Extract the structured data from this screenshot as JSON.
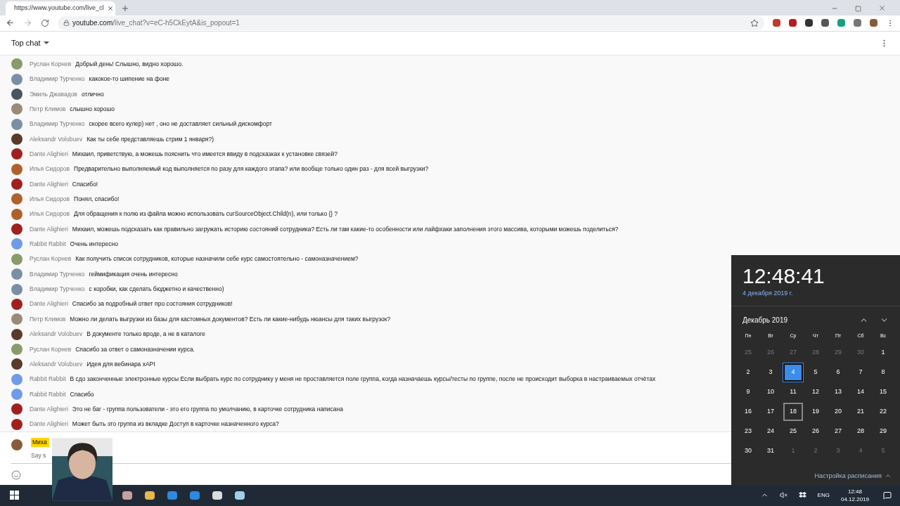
{
  "browser": {
    "tab_title": "https://www.youtube.com/live_cl",
    "url_host": "youtube.com",
    "url_path": "/live_chat?v=eC-h5CkEytA&is_popout=1"
  },
  "chat": {
    "mode": "Top chat",
    "messages": [
      {
        "author": "Руслан Корнев",
        "text": "Добрый день! Слышно, видно хорошо.",
        "color": "#8a9a6a"
      },
      {
        "author": "Владимир Турченко",
        "text": "какокое-то шипение на фоне",
        "color": "#7a8fa6"
      },
      {
        "author": "Эмиль Джавадов",
        "text": "отлично",
        "color": "#4a5562"
      },
      {
        "author": "Петр Климов",
        "text": "слышно хорошо",
        "color": "#9a8a78"
      },
      {
        "author": "Владимир Турченко",
        "text": "скорее всего кулер) нет , оно не доставляет сильный дискомфорт",
        "color": "#7a8fa6"
      },
      {
        "author": "Aleksandr Volobuev",
        "text": "Как ты себе представляешь стрим 1 января?)",
        "color": "#5a3a2a"
      },
      {
        "author": "Dante Alighieri",
        "text": "Михаил, приветствую, а можешь пояснить что имеется ввиду в подсказках к установке связей?",
        "color": "#a02020"
      },
      {
        "author": "Илья Сидоров",
        "text": "Предварительно выполняемый код выполняется по разу для каждого этапа? или вообще только один раз - для всей выгрузки?",
        "color": "#b0602a"
      },
      {
        "author": "Dante Alighieri",
        "text": "Спасибо!",
        "color": "#a02020"
      },
      {
        "author": "Илья Сидоров",
        "text": "Понял, спасибо!",
        "color": "#b0602a"
      },
      {
        "author": "Илья Сидоров",
        "text": "Для обращения к полю из файла можно использовать curSourceObject.Child(n), или только {} ?",
        "color": "#b0602a"
      },
      {
        "author": "Dante Alighieri",
        "text": "Михаил, можешь подсказать как правильно загружать историю состояний сотрудника? Есть ли там какие-то особенности или лайфхаки заполнения этого массива, которыми можешь поделиться?",
        "color": "#a02020"
      },
      {
        "author": "Rabbit Rabbit",
        "text": "Очень интересно",
        "color": "#6f9be8"
      },
      {
        "author": "Руслан Корнев",
        "text": "Как получить список сотрудников, которые назначили себе курс самостоятельно - самоназначением?",
        "color": "#8a9a6a"
      },
      {
        "author": "Владимир Турченко",
        "text": "геймификация очень интересно",
        "color": "#7a8fa6"
      },
      {
        "author": "Владимир Турченко",
        "text": "с коробки, как сделать бюджетно и качественно)",
        "color": "#7a8fa6"
      },
      {
        "author": "Dante Alighieri",
        "text": "Спасибо за подробный ответ про состояния сотрудников!",
        "color": "#a02020"
      },
      {
        "author": "Петр Климов",
        "text": "Можно ли делать выгрузки из базы для кастомных документов? Есть ли какие-нибудь нюансы для таких выгрузок?",
        "color": "#9a8a78"
      },
      {
        "author": "Aleksandr Volobuev",
        "text": "В документе только вроде, а не в каталоге",
        "color": "#5a3a2a"
      },
      {
        "author": "Руслан Корнев",
        "text": "Спасибо за ответ о самоназначении курса.",
        "color": "#8a9a6a"
      },
      {
        "author": "Aleksandr Volobuev",
        "text": "Идея для вебинара xAPI",
        "color": "#5a3a2a"
      },
      {
        "author": "Rabbit Rabbit",
        "text": "В сдо законченные электронные курсы Если выбрать курс по сотруднику у меня не проставляется поле группа, когда назначаешь курсы/тесты по группе, после не происходит выборка в настраиваемых отчётах",
        "color": "#6f9be8"
      },
      {
        "author": "Rabbit Rabbit",
        "text": "Спасибо",
        "color": "#6f9be8"
      },
      {
        "author": "Dante Alighieri",
        "text": "Это не баг - группа пользователи - это его группа по умолчанию, в карточке сотрудника написана",
        "color": "#a02020"
      },
      {
        "author": "Dante Alighieri",
        "text": "Может быть это группа из вкладке Доступ в карточке назначенного курса?",
        "color": "#a02020"
      }
    ],
    "composer": {
      "author": "Миха",
      "placeholder": "Say s"
    }
  },
  "clock": {
    "time": "12:48:41",
    "date": "4 декабря 2019 г.",
    "month": "Декабрь 2019",
    "weekdays": [
      "Пн",
      "Вт",
      "Ср",
      "Чт",
      "Пт",
      "Сб",
      "Вс"
    ],
    "days": [
      {
        "label": "25",
        "kind": "other",
        "selected": false,
        "hovered": false
      },
      {
        "label": "26",
        "kind": "other",
        "selected": false,
        "hovered": false
      },
      {
        "label": "27",
        "kind": "other",
        "selected": false,
        "hovered": false
      },
      {
        "label": "28",
        "kind": "other",
        "selected": false,
        "hovered": false
      },
      {
        "label": "29",
        "kind": "other",
        "selected": false,
        "hovered": false
      },
      {
        "label": "30",
        "kind": "other",
        "selected": false,
        "hovered": false
      },
      {
        "label": "1",
        "kind": "month",
        "selected": false,
        "hovered": false
      },
      {
        "label": "2",
        "kind": "month",
        "selected": false,
        "hovered": false
      },
      {
        "label": "3",
        "kind": "month",
        "selected": false,
        "hovered": false
      },
      {
        "label": "4",
        "kind": "month",
        "selected": true,
        "hovered": false
      },
      {
        "label": "5",
        "kind": "month",
        "selected": false,
        "hovered": false
      },
      {
        "label": "6",
        "kind": "month",
        "selected": false,
        "hovered": false
      },
      {
        "label": "7",
        "kind": "month",
        "selected": false,
        "hovered": false
      },
      {
        "label": "8",
        "kind": "month",
        "selected": false,
        "hovered": false
      },
      {
        "label": "9",
        "kind": "month",
        "selected": false,
        "hovered": false
      },
      {
        "label": "10",
        "kind": "month",
        "selected": false,
        "hovered": false
      },
      {
        "label": "11",
        "kind": "month",
        "selected": false,
        "hovered": false
      },
      {
        "label": "12",
        "kind": "month",
        "selected": false,
        "hovered": false
      },
      {
        "label": "13",
        "kind": "month",
        "selected": false,
        "hovered": false
      },
      {
        "label": "14",
        "kind": "month",
        "selected": false,
        "hovered": false
      },
      {
        "label": "15",
        "kind": "month",
        "selected": false,
        "hovered": false
      },
      {
        "label": "16",
        "kind": "month",
        "selected": false,
        "hovered": false
      },
      {
        "label": "17",
        "kind": "month",
        "selected": false,
        "hovered": false
      },
      {
        "label": "18",
        "kind": "month",
        "selected": false,
        "hovered": true
      },
      {
        "label": "19",
        "kind": "month",
        "selected": false,
        "hovered": false
      },
      {
        "label": "20",
        "kind": "month",
        "selected": false,
        "hovered": false
      },
      {
        "label": "21",
        "kind": "month",
        "selected": false,
        "hovered": false
      },
      {
        "label": "22",
        "kind": "month",
        "selected": false,
        "hovered": false
      },
      {
        "label": "23",
        "kind": "month",
        "selected": false,
        "hovered": false
      },
      {
        "label": "24",
        "kind": "month",
        "selected": false,
        "hovered": false
      },
      {
        "label": "25",
        "kind": "month",
        "selected": false,
        "hovered": false
      },
      {
        "label": "26",
        "kind": "month",
        "selected": false,
        "hovered": false
      },
      {
        "label": "27",
        "kind": "month",
        "selected": false,
        "hovered": false
      },
      {
        "label": "28",
        "kind": "month",
        "selected": false,
        "hovered": false
      },
      {
        "label": "29",
        "kind": "month",
        "selected": false,
        "hovered": false
      },
      {
        "label": "30",
        "kind": "month",
        "selected": false,
        "hovered": false
      },
      {
        "label": "31",
        "kind": "month",
        "selected": false,
        "hovered": false
      },
      {
        "label": "1",
        "kind": "other",
        "selected": false,
        "hovered": false
      },
      {
        "label": "2",
        "kind": "other",
        "selected": false,
        "hovered": false
      },
      {
        "label": "3",
        "kind": "other",
        "selected": false,
        "hovered": false
      },
      {
        "label": "4",
        "kind": "other",
        "selected": false,
        "hovered": false
      },
      {
        "label": "5",
        "kind": "other",
        "selected": false,
        "hovered": false
      }
    ],
    "footer": "Настройка расписания"
  },
  "taskbar": {
    "language": "ENG",
    "time": "12:48",
    "date": "04.12.2019"
  }
}
